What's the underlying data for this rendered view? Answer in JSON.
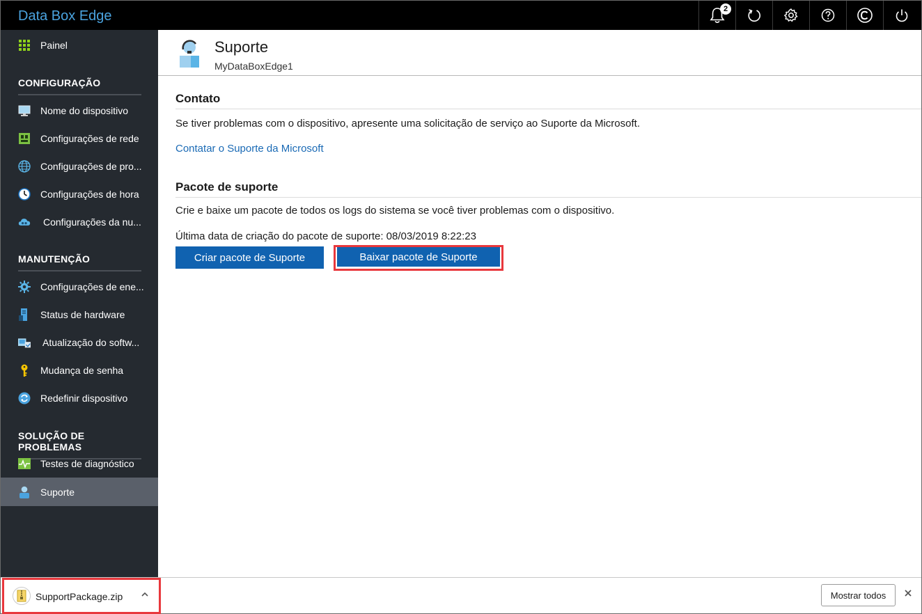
{
  "app": {
    "title": "Data Box Edge"
  },
  "topbar": {
    "notification_count": "2"
  },
  "sidebar": {
    "dashboard": "Painel",
    "sections": [
      {
        "title": "CONFIGURAÇÃO",
        "items": [
          {
            "label": "Nome do dispositivo",
            "icon": "monitor-icon"
          },
          {
            "label": "Configurações de rede",
            "icon": "network-icon"
          },
          {
            "label": "Configurações de pro...",
            "icon": "globe-icon"
          },
          {
            "label": "Configurações de hora",
            "icon": "clock-icon"
          },
          {
            "label": "Configurações da nu...",
            "icon": "cloud-icon"
          }
        ]
      },
      {
        "title": "MANUTENÇÃO",
        "items": [
          {
            "label": "Configurações de ene...",
            "icon": "gear-icon"
          },
          {
            "label": "Status de hardware",
            "icon": "server-icon"
          },
          {
            "label": "Atualização do softw...",
            "icon": "update-icon"
          },
          {
            "label": "Mudança de senha",
            "icon": "key-icon"
          },
          {
            "label": "Redefinir dispositivo",
            "icon": "reset-icon"
          }
        ]
      },
      {
        "title": "SOLUÇÃO DE PROBLEMAS",
        "items": [
          {
            "label": "Testes de diagnóstico",
            "icon": "pulse-icon"
          },
          {
            "label": "Suporte",
            "icon": "support-icon"
          }
        ]
      }
    ]
  },
  "page": {
    "title": "Suporte",
    "subtitle": "MyDataBoxEdge1",
    "contact": {
      "heading": "Contato",
      "description": "Se tiver problemas com o dispositivo, apresente uma solicitação de serviço ao Suporte da Microsoft.",
      "link": "Contatar o Suporte da Microsoft"
    },
    "package": {
      "heading": "Pacote de suporte",
      "description": "Crie e baixe um pacote de todos os logs do sistema se você tiver problemas com o dispositivo.",
      "last_created": "Última data de criação do pacote de suporte: 08/03/2019 8:22:23",
      "create_button": "Criar pacote de Suporte",
      "download_button": "Baixar pacote de Suporte"
    }
  },
  "downloads": {
    "file_name": "SupportPackage.zip",
    "show_all": "Mostrar todos"
  },
  "colors": {
    "accent": "#1062b0",
    "brand_text": "#4aa3df",
    "highlight": "#e8383d",
    "sidebar_bg": "#252a30"
  }
}
